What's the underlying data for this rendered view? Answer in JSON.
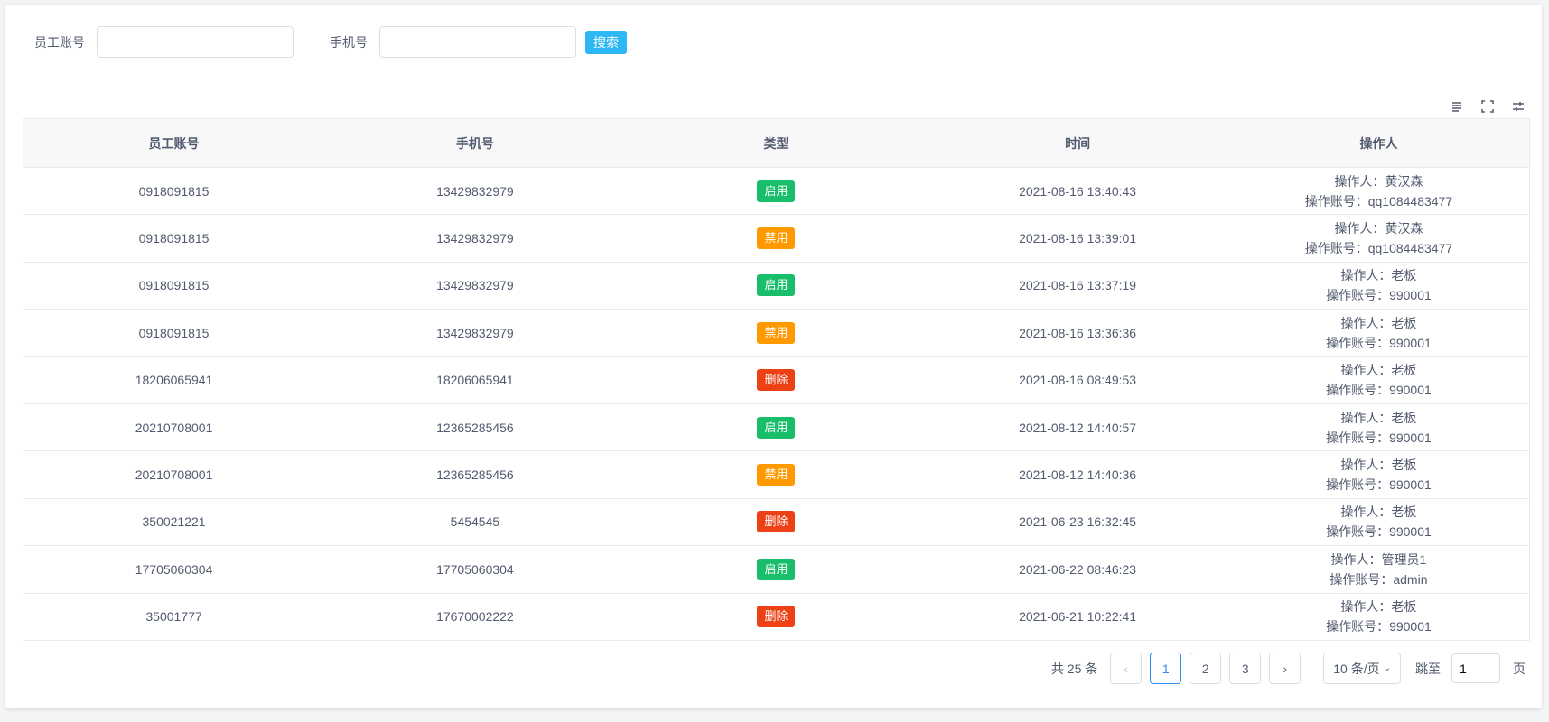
{
  "search": {
    "account_label": "员工账号",
    "account_value": "",
    "phone_label": "手机号",
    "phone_value": "",
    "button": "搜索",
    "button_color": "#2db7f5"
  },
  "toolbar": {
    "icons": [
      "align-icon",
      "fullscreen-icon",
      "columns-settings-icon"
    ]
  },
  "table": {
    "headers": [
      "员工账号",
      "手机号",
      "类型",
      "时间",
      "操作人"
    ],
    "type_colors": {
      "启用": "#19be6b",
      "禁用": "#ff9900",
      "删除": "#ed4014"
    },
    "rows": [
      {
        "account": "0918091815",
        "phone": "13429832979",
        "type": "启用",
        "time": "2021-08-16 13:40:43",
        "operator": "操作人：黄汉森",
        "operator_account": "操作账号：qq1084483477"
      },
      {
        "account": "0918091815",
        "phone": "13429832979",
        "type": "禁用",
        "time": "2021-08-16 13:39:01",
        "operator": "操作人：黄汉森",
        "operator_account": "操作账号：qq1084483477"
      },
      {
        "account": "0918091815",
        "phone": "13429832979",
        "type": "启用",
        "time": "2021-08-16 13:37:19",
        "operator": "操作人：老板",
        "operator_account": "操作账号：990001"
      },
      {
        "account": "0918091815",
        "phone": "13429832979",
        "type": "禁用",
        "time": "2021-08-16 13:36:36",
        "operator": "操作人：老板",
        "operator_account": "操作账号：990001"
      },
      {
        "account": "18206065941",
        "phone": "18206065941",
        "type": "删除",
        "time": "2021-08-16 08:49:53",
        "operator": "操作人：老板",
        "operator_account": "操作账号：990001"
      },
      {
        "account": "20210708001",
        "phone": "12365285456",
        "type": "启用",
        "time": "2021-08-12 14:40:57",
        "operator": "操作人：老板",
        "operator_account": "操作账号：990001"
      },
      {
        "account": "20210708001",
        "phone": "12365285456",
        "type": "禁用",
        "time": "2021-08-12 14:40:36",
        "operator": "操作人：老板",
        "operator_account": "操作账号：990001"
      },
      {
        "account": "350021221",
        "phone": "5454545",
        "type": "删除",
        "time": "2021-06-23 16:32:45",
        "operator": "操作人：老板",
        "operator_account": "操作账号：990001"
      },
      {
        "account": "17705060304",
        "phone": "17705060304",
        "type": "启用",
        "time": "2021-06-22 08:46:23",
        "operator": "操作人：管理员1",
        "operator_account": "操作账号：admin"
      },
      {
        "account": "35001777",
        "phone": "17670002222",
        "type": "删除",
        "time": "2021-06-21 10:22:41",
        "operator": "操作人：老板",
        "operator_account": "操作账号：990001"
      }
    ]
  },
  "pagination": {
    "total": "共 25 条",
    "prev": "‹",
    "pages": [
      "1",
      "2",
      "3"
    ],
    "current": "1",
    "next": "›",
    "page_size": "10 条/页",
    "jump_label": "跳至",
    "jump_value": "1",
    "page_suffix": "页"
  }
}
